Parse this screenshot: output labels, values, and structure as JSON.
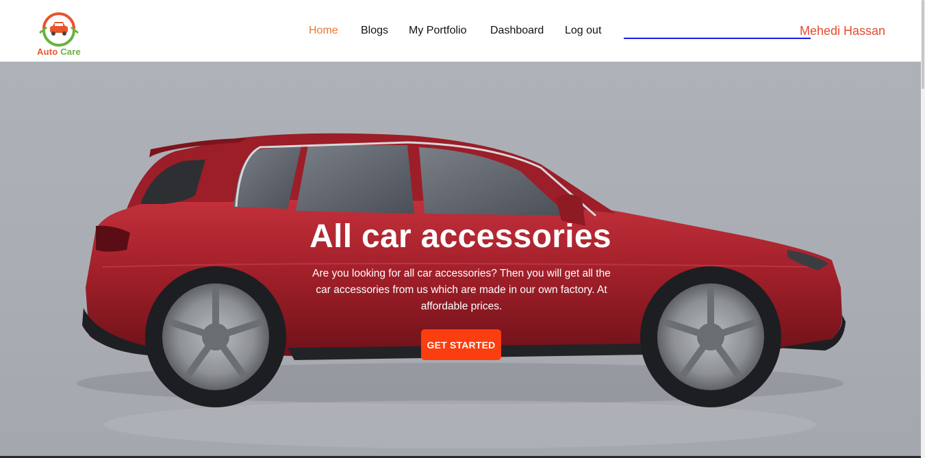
{
  "brand": {
    "name_part1": "Auto",
    "name_part2": "Care"
  },
  "nav": {
    "items": [
      {
        "label": "Home",
        "active": true
      },
      {
        "label": "Blogs",
        "active": false
      },
      {
        "label": "My Portfolio",
        "active": false
      },
      {
        "label": "Dashboard",
        "active": false
      },
      {
        "label": "Log out",
        "active": false
      }
    ],
    "user_name": "Mehedi Hassan"
  },
  "hero": {
    "title": "All car accessories",
    "subtitle": "Are you looking for all car accessories? Then you will get all the car accessories from us which are made in our own factory. At affordable prices.",
    "cta_label": "GET STARTED"
  },
  "colors": {
    "accent": "#fb3e0f",
    "active_nav": "#e9782e",
    "user_name": "#e64a2e",
    "underline": "#1a1ae6",
    "hero_bg": "#aeb2b8",
    "car_body": "#a3202a"
  }
}
